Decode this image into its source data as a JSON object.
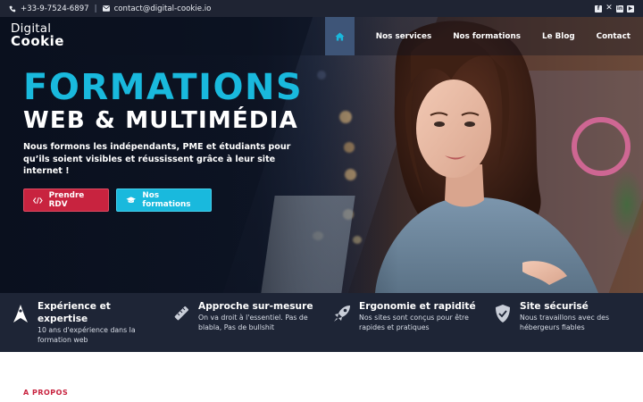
{
  "topbar": {
    "phone": "+33-9-7524-6897",
    "separator": "|",
    "email": "contact@digital-cookie.io",
    "socials": [
      "facebook-icon",
      "x-icon",
      "linkedin-icon",
      "youtube-icon"
    ]
  },
  "logo": {
    "line1": "Digital",
    "line2": "Cookie"
  },
  "nav": {
    "home_icon": "home-icon",
    "items": [
      {
        "label": "Nos services"
      },
      {
        "label": "Nos formations"
      },
      {
        "label": "Le Blog"
      },
      {
        "label": "Contact"
      }
    ]
  },
  "hero": {
    "title_line1": "FORMATIONS",
    "title_line2": "WEB & MULTIMÉDIA",
    "lead": "Nous formons les indépendants, PME et étudiants pour qu’ils soient visibles et réussissent grâce à leur site internet !",
    "cta_primary": "Prendre RDV",
    "cta_secondary": "Nos formations"
  },
  "features": [
    {
      "icon": "rocket-launch-icon",
      "title": "Expérience et expertise",
      "desc": "10 ans d'expérience dans la formation web"
    },
    {
      "icon": "ruler-icon",
      "title": "Approche sur-mesure",
      "desc": "On va droit à l'essentiel. Pas de blabla, Pas de bullshit"
    },
    {
      "icon": "rocket-icon",
      "title": "Ergonomie et rapidité",
      "desc": "Nos sites sont conçus pour être rapides et pratiques"
    },
    {
      "icon": "shield-check-icon",
      "title": "Site sécurisé",
      "desc": "Nous travaillons avec des hébergeurs fiables"
    }
  ],
  "section": {
    "label": "A PROPOS"
  },
  "colors": {
    "accent_cyan": "#19b9dd",
    "accent_red": "#c8233f",
    "dark": "#1e2536",
    "nav_home": "#3e5578"
  }
}
